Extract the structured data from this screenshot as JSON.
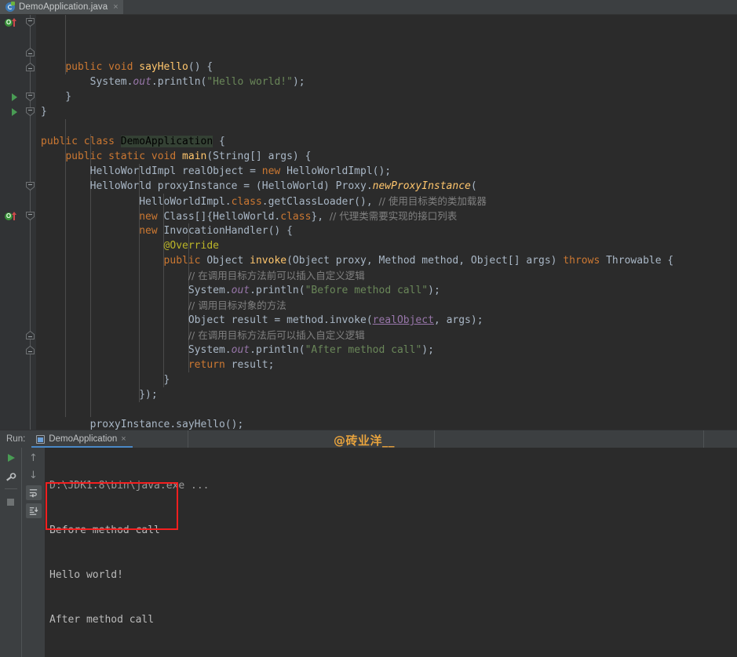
{
  "window": {
    "theme_background": "#2b2b2b",
    "accent": "#4a88c7"
  },
  "tabbar": {
    "tabs": [
      {
        "title": "DemoApplication.java",
        "icon": "java-class-icon",
        "close": "×",
        "active": true
      }
    ]
  },
  "editor": {
    "language": "java",
    "lines": [
      {
        "id": 1,
        "tokens": [
          {
            "t": "    ",
            "c": "txt"
          },
          {
            "t": "public",
            "c": "kw"
          },
          {
            "t": " ",
            "c": "txt"
          },
          {
            "t": "void",
            "c": "kw"
          },
          {
            "t": " ",
            "c": "txt"
          },
          {
            "t": "sayHello",
            "c": "fnc"
          },
          {
            "t": "() {",
            "c": "txt"
          }
        ]
      },
      {
        "id": 2,
        "tokens": [
          {
            "t": "        ",
            "c": "txt"
          },
          {
            "t": "System",
            "c": "txt"
          },
          {
            "t": ".",
            "c": "txt"
          },
          {
            "t": "out",
            "c": "fld"
          },
          {
            "t": ".println(",
            "c": "txt"
          },
          {
            "t": "\"Hello world!\"",
            "c": "str"
          },
          {
            "t": ");",
            "c": "txt"
          }
        ]
      },
      {
        "id": 3,
        "tokens": [
          {
            "t": "    }",
            "c": "txt"
          }
        ]
      },
      {
        "id": 4,
        "tokens": [
          {
            "t": "}",
            "c": "txt"
          }
        ]
      },
      {
        "id": 5,
        "tokens": []
      },
      {
        "id": 6,
        "tokens": [
          {
            "t": "public",
            "c": "kw"
          },
          {
            "t": " ",
            "c": "txt"
          },
          {
            "t": "class",
            "c": "kw"
          },
          {
            "t": " ",
            "c": "txt"
          },
          {
            "t": "DemoApplication",
            "c": "hl-ident"
          },
          {
            "t": " {",
            "c": "txt"
          }
        ]
      },
      {
        "id": 7,
        "tokens": [
          {
            "t": "    ",
            "c": "txt"
          },
          {
            "t": "public",
            "c": "kw"
          },
          {
            "t": " ",
            "c": "txt"
          },
          {
            "t": "static",
            "c": "kw"
          },
          {
            "t": " ",
            "c": "txt"
          },
          {
            "t": "void",
            "c": "kw"
          },
          {
            "t": " ",
            "c": "txt"
          },
          {
            "t": "main",
            "c": "fnc"
          },
          {
            "t": "(String[] args) {",
            "c": "txt"
          }
        ]
      },
      {
        "id": 8,
        "tokens": [
          {
            "t": "        HelloWorldImpl realObject = ",
            "c": "txt"
          },
          {
            "t": "new",
            "c": "kw"
          },
          {
            "t": " HelloWorldImpl();",
            "c": "txt"
          }
        ]
      },
      {
        "id": 9,
        "tokens": [
          {
            "t": "        HelloWorld proxyInstance = (HelloWorld) Proxy.",
            "c": "txt"
          },
          {
            "t": "newProxyInstance",
            "c": "stm"
          },
          {
            "t": "(",
            "c": "txt"
          }
        ]
      },
      {
        "id": 10,
        "tokens": [
          {
            "t": "                HelloWorldImpl.",
            "c": "txt"
          },
          {
            "t": "class",
            "c": "kw"
          },
          {
            "t": ".getClassLoader(), ",
            "c": "txt"
          },
          {
            "t": "// 使用目标类的类加载器",
            "c": "cmtz"
          }
        ]
      },
      {
        "id": 11,
        "tokens": [
          {
            "t": "                ",
            "c": "txt"
          },
          {
            "t": "new",
            "c": "kw"
          },
          {
            "t": " Class[]{HelloWorld.",
            "c": "txt"
          },
          {
            "t": "class",
            "c": "kw"
          },
          {
            "t": "}, ",
            "c": "txt"
          },
          {
            "t": "// 代理类需要实现的接口列表",
            "c": "cmtz"
          }
        ]
      },
      {
        "id": 12,
        "tokens": [
          {
            "t": "                ",
            "c": "txt"
          },
          {
            "t": "new",
            "c": "kw"
          },
          {
            "t": " InvocationHandler() {",
            "c": "txt"
          }
        ]
      },
      {
        "id": 13,
        "tokens": [
          {
            "t": "                    ",
            "c": "txt"
          },
          {
            "t": "@Override",
            "c": "anno"
          }
        ]
      },
      {
        "id": 14,
        "tokens": [
          {
            "t": "                    ",
            "c": "txt"
          },
          {
            "t": "public",
            "c": "kw"
          },
          {
            "t": " Object ",
            "c": "txt"
          },
          {
            "t": "invoke",
            "c": "fnc"
          },
          {
            "t": "(Object proxy, Method method, Object[] args) ",
            "c": "txt"
          },
          {
            "t": "throws",
            "c": "kw"
          },
          {
            "t": " Throwable {",
            "c": "txt"
          }
        ]
      },
      {
        "id": 15,
        "tokens": [
          {
            "t": "                        ",
            "c": "txt"
          },
          {
            "t": "// 在调用目标方法前可以插入自定义逻辑",
            "c": "cmtz"
          }
        ]
      },
      {
        "id": 16,
        "tokens": [
          {
            "t": "                        System.",
            "c": "txt"
          },
          {
            "t": "out",
            "c": "fld"
          },
          {
            "t": ".println(",
            "c": "txt"
          },
          {
            "t": "\"Before method call\"",
            "c": "str"
          },
          {
            "t": ");",
            "c": "txt"
          }
        ]
      },
      {
        "id": 17,
        "tokens": [
          {
            "t": "                        ",
            "c": "txt"
          },
          {
            "t": "// 调用目标对象的方法",
            "c": "cmtz"
          }
        ]
      },
      {
        "id": 18,
        "tokens": [
          {
            "t": "                        Object result = method.invoke(",
            "c": "txt"
          },
          {
            "t": "realObject",
            "c": "var-underline"
          },
          {
            "t": ", args);",
            "c": "txt"
          }
        ]
      },
      {
        "id": 19,
        "tokens": [
          {
            "t": "                        ",
            "c": "txt"
          },
          {
            "t": "// 在调用目标方法后可以插入自定义逻辑",
            "c": "cmtz"
          }
        ]
      },
      {
        "id": 20,
        "tokens": [
          {
            "t": "                        System.",
            "c": "txt"
          },
          {
            "t": "out",
            "c": "fld"
          },
          {
            "t": ".println(",
            "c": "txt"
          },
          {
            "t": "\"After method call\"",
            "c": "str"
          },
          {
            "t": ");",
            "c": "txt"
          }
        ]
      },
      {
        "id": 21,
        "tokens": [
          {
            "t": "                        ",
            "c": "txt"
          },
          {
            "t": "return",
            "c": "kw"
          },
          {
            "t": " result;",
            "c": "txt"
          }
        ]
      },
      {
        "id": 22,
        "tokens": [
          {
            "t": "                    }",
            "c": "txt"
          }
        ]
      },
      {
        "id": 23,
        "tokens": [
          {
            "t": "                });",
            "c": "txt"
          }
        ]
      },
      {
        "id": 24,
        "tokens": []
      },
      {
        "id": 25,
        "tokens": [
          {
            "t": "        proxyInstance.sayHello();",
            "c": "txt"
          }
        ]
      }
    ]
  },
  "gutter": {
    "markers": [
      {
        "type": "override-icon",
        "line": 1,
        "glyph": "O"
      },
      {
        "type": "run-gutter-icon",
        "line": 6
      },
      {
        "type": "run-gutter-icon",
        "line": 7
      },
      {
        "type": "override-icon",
        "line": 14,
        "glyph": "O"
      }
    ]
  },
  "run_panel": {
    "label": "Run:",
    "tab": {
      "title": "DemoApplication",
      "close": "×"
    },
    "watermark": "@砖业洋__",
    "watermark_color": "#e8a33d",
    "toolbar": {
      "rerun": "run-icon",
      "settings": "wrench-icon",
      "stop": "stop-icon",
      "up": "↑",
      "down": "↓",
      "soft_wrap": "soft-wrap-icon",
      "scroll_to_end": "scroll-to-end-icon"
    },
    "console": {
      "command_line": "D:\\JDK1.8\\bin\\java.exe ...",
      "output": [
        "Before method call",
        "Hello world!",
        "After method call"
      ],
      "highlight_color": "#f41f1f"
    }
  }
}
